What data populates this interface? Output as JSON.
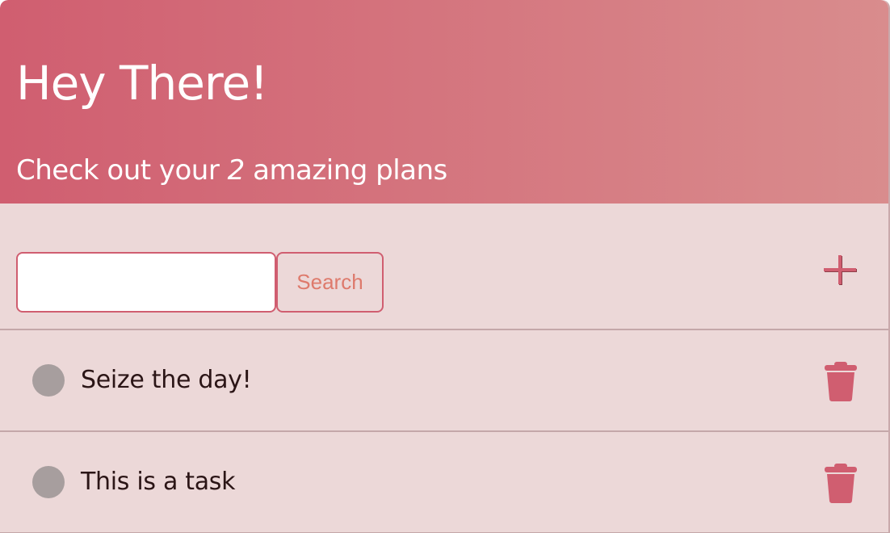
{
  "header": {
    "greeting": "Hey There!",
    "subtitle_prefix": "Check out your ",
    "task_count": "2",
    "subtitle_suffix": " amazing plans"
  },
  "search": {
    "value": "",
    "placeholder": "",
    "button_label": "Search"
  },
  "tasks": [
    {
      "text": "Seize the day!"
    },
    {
      "text": "This is a task"
    }
  ],
  "icons": {
    "add": "plus-icon",
    "delete": "trash-icon",
    "check": "circle-icon"
  },
  "colors": {
    "accent": "#d05e70",
    "background": "#ecd8d8",
    "search_text": "#de7a6c",
    "check_circle": "#a79e9e"
  }
}
